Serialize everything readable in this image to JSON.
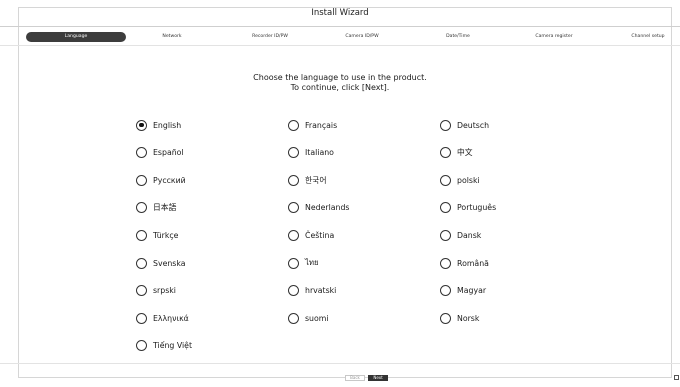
{
  "window": {
    "title": "Install Wizard"
  },
  "steps": [
    {
      "label": "Language",
      "active": true
    },
    {
      "label": "Network",
      "active": false
    },
    {
      "label": "Recorder ID/PW",
      "active": false
    },
    {
      "label": "Camera ID/PW",
      "active": false
    },
    {
      "label": "Date/Time",
      "active": false
    },
    {
      "label": "Camera register",
      "active": false
    },
    {
      "label": "Channel setup",
      "active": false
    }
  ],
  "prompt": {
    "line1": "Choose the language to use in the product.",
    "line2": "To continue, click [Next]."
  },
  "languages": [
    {
      "label": "English",
      "selected": true
    },
    {
      "label": "Français",
      "selected": false
    },
    {
      "label": "Deutsch",
      "selected": false
    },
    {
      "label": "Español",
      "selected": false
    },
    {
      "label": "Italiano",
      "selected": false
    },
    {
      "label": "中文",
      "selected": false
    },
    {
      "label": "Русский",
      "selected": false
    },
    {
      "label": "한국어",
      "selected": false
    },
    {
      "label": "polski",
      "selected": false
    },
    {
      "label": "日本語",
      "selected": false
    },
    {
      "label": "Nederlands",
      "selected": false
    },
    {
      "label": "Português",
      "selected": false
    },
    {
      "label": "Türkçe",
      "selected": false
    },
    {
      "label": "Čeština",
      "selected": false
    },
    {
      "label": "Dansk",
      "selected": false
    },
    {
      "label": "Svenska",
      "selected": false
    },
    {
      "label": "ไทย",
      "selected": false
    },
    {
      "label": "Română",
      "selected": false
    },
    {
      "label": "srpski",
      "selected": false
    },
    {
      "label": "hrvatski",
      "selected": false
    },
    {
      "label": "Magyar",
      "selected": false
    },
    {
      "label": "Ελληνικά",
      "selected": false
    },
    {
      "label": "suomi",
      "selected": false
    },
    {
      "label": "Norsk",
      "selected": false
    },
    {
      "label": "Tiếng Việt",
      "selected": false
    }
  ],
  "footer": {
    "back_label": "Back",
    "next_label": "Next"
  }
}
